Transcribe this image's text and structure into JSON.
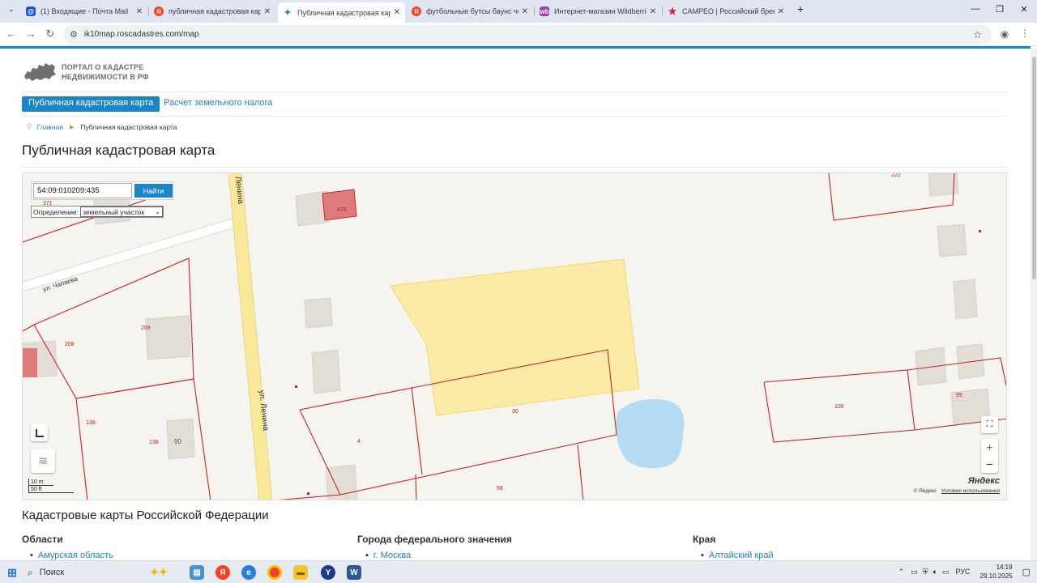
{
  "browser": {
    "tabs": [
      {
        "label": "(1) Входящие - Почта Mail",
        "icon": "mail-icon",
        "color": "#1a5ad7",
        "active": false
      },
      {
        "label": "публичная кадастровая карта",
        "icon": "yandex-icon",
        "color": "#fc3f1d",
        "active": false
      },
      {
        "label": "Публичная кадастровая карта",
        "icon": "roscadastre-icon",
        "color": "#1a86c7",
        "active": true
      },
      {
        "label": "футбольные бутсы баунс черн",
        "icon": "yandex-icon",
        "color": "#fc3f1d",
        "active": false
      },
      {
        "label": "Интернет-магазин Wildberries",
        "icon": "wildberries-icon",
        "color": "#a43cb2",
        "active": false
      },
      {
        "label": "CAMPEO | Российский бренд с",
        "icon": "star-icon",
        "color": "#d22020",
        "active": false
      }
    ],
    "new_tab_symbol": "+",
    "url": "ik10map.roscadastres.com/map"
  },
  "site": {
    "logo_line1": "ПОРТАЛ О КАДАСТРЕ",
    "logo_line2": "НЕДВИЖИМОСТИ В РФ",
    "nav": [
      "Публичная кадастровая карта",
      "Расчет земельного налога"
    ],
    "breadcrumb": {
      "home": "Главная",
      "current": "Публичная кадастровая карта"
    },
    "title": "Публичная кадастровая карта"
  },
  "map": {
    "search_value": "54:09:010209:435",
    "search_button": "Найти",
    "definition_label": "Определение:",
    "definition_value": "земельный участок",
    "parcel_numbers": [
      "371",
      "476",
      "208",
      "208",
      "138",
      "138",
      "90",
      "4",
      "30",
      "58",
      "100",
      "99",
      "222"
    ],
    "street_labels": [
      "ул. Чапаева",
      "ул. Ленина",
      "ул. Ленина"
    ],
    "scale_m": "10 m",
    "scale_ft": "50 ft",
    "zoom_in": "+",
    "zoom_out": "−",
    "provider": "Яндекс",
    "copyright": "© Яндекс",
    "terms": "Условия использования",
    "colors": {
      "highlight": "#fbe99a",
      "boundary": "#c8232c",
      "water": "#b5dcf4",
      "road": "#fbe99a"
    }
  },
  "regions": {
    "title": "Кадастровые карты Российской Федерации",
    "columns": [
      {
        "heading": "Области",
        "first": "Амурская область"
      },
      {
        "heading": "Города федерального значения",
        "first": "г. Москва"
      },
      {
        "heading": "Края",
        "first": "Алтайский край"
      }
    ]
  },
  "taskbar": {
    "search": "Поиск",
    "lang": "РУС",
    "time": "14:19",
    "date": "29.10.2025"
  }
}
